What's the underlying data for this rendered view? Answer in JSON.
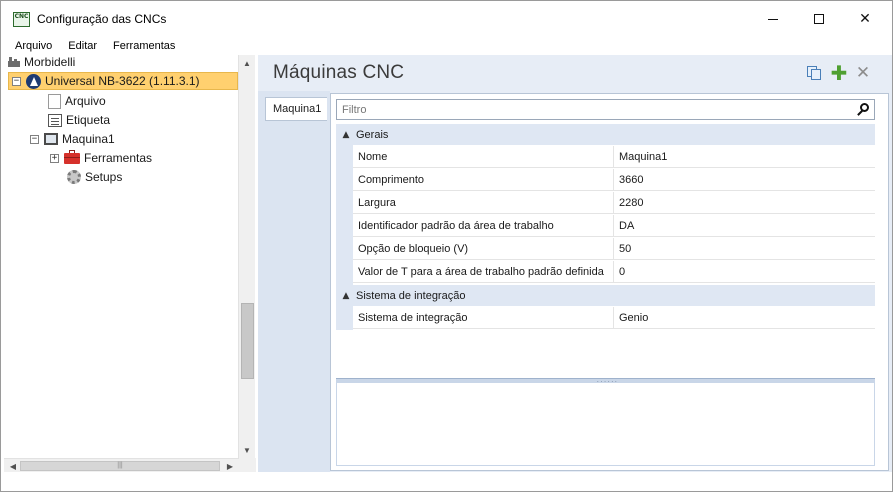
{
  "window": {
    "title": "Configuração das CNCs",
    "app_icon_text": "CNC",
    "minimize_icon": "minimize-icon",
    "maximize_icon": "maximize-icon",
    "close_icon": "close-icon",
    "close_glyph": "✕"
  },
  "menu": {
    "items": [
      "Arquivo",
      "Editar",
      "Ferramentas"
    ]
  },
  "tree": {
    "root": "Morbidelli",
    "selected": "Universal NB-3622 (1.11.3.1)",
    "nodes": {
      "arquivo": "Arquivo",
      "etiqueta": "Etiqueta",
      "maquina": "Maquina1",
      "ferramentas": "Ferramentas",
      "setups": "Setups"
    },
    "expander_minus": "−",
    "expander_plus": "+",
    "scroll_up": "▲",
    "scroll_down": "▼",
    "scroll_left": "◀",
    "scroll_right": "▶",
    "hscroll_grip": "|||"
  },
  "main": {
    "title": "Máquinas CNC",
    "actions": {
      "add_glyph": "✚",
      "delete_glyph": "✕"
    },
    "tab": "Maquina1",
    "filter_placeholder": "Filtro",
    "categories": [
      {
        "name": "Gerais",
        "caret": "▲",
        "properties": [
          {
            "name": "Nome",
            "value": "Maquina1"
          },
          {
            "name": "Comprimento",
            "value": "3660"
          },
          {
            "name": "Largura",
            "value": "2280"
          },
          {
            "name": "Identificador padrão da área de trabalho",
            "value": "DA"
          },
          {
            "name": "Opção de bloqueio (V)",
            "value": "50"
          },
          {
            "name": "Valor de T para a área de trabalho padrão definida",
            "value": "0"
          }
        ]
      },
      {
        "name": "Sistema de integração",
        "caret": "▲",
        "properties": [
          {
            "name": "Sistema de integração",
            "value": "Genio"
          }
        ]
      }
    ],
    "splitter_grip": "......"
  },
  "colors": {
    "selection": "#ffd06f",
    "pane_background": "#e7edf6",
    "category_background": "#dfe7f3",
    "add_green": "#4fa031"
  }
}
